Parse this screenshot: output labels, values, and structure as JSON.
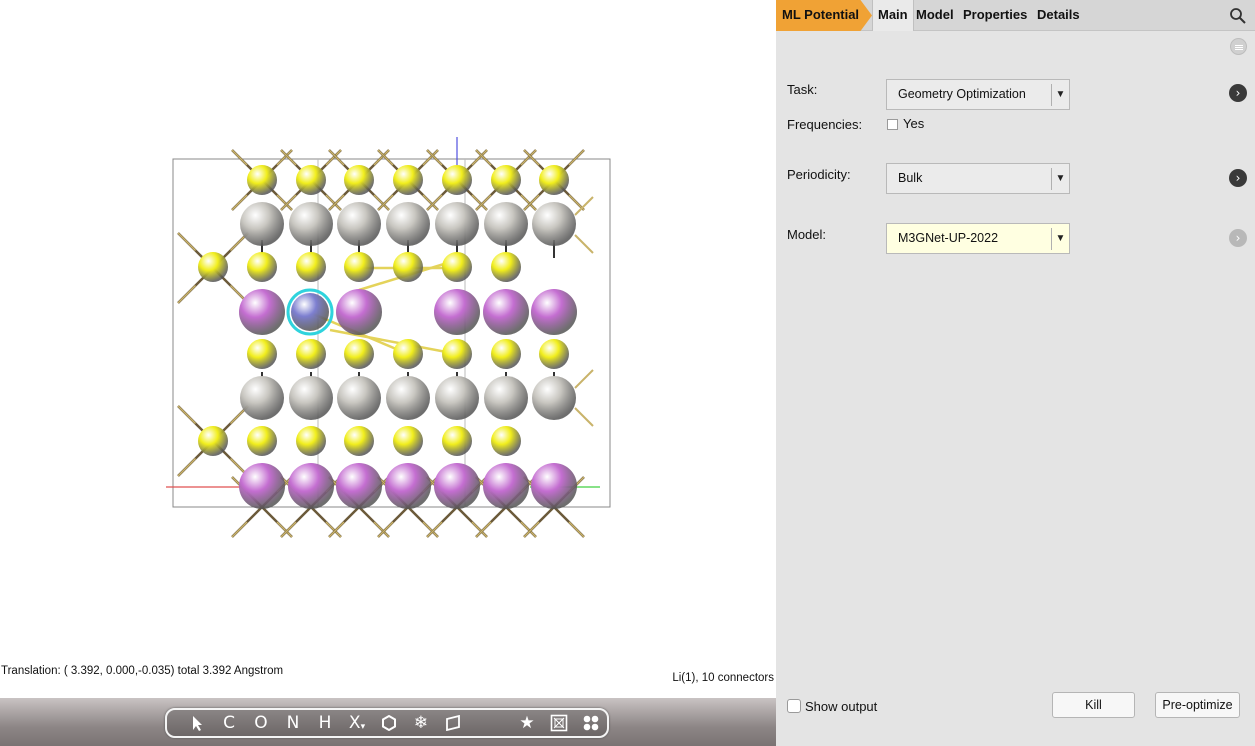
{
  "viewer": {
    "status_left": "Translation: ( 3.392, 0.000,-0.035) total  3.392 Angstrom",
    "status_right": "Li(1), 10 connectors",
    "colors": {
      "S": "#f1ee1c",
      "Ti": "#c8c6c0",
      "Li": "#c46ed1",
      "selected": "#7d7fd0",
      "highlight": "#2fd3dd"
    }
  },
  "toolbar": {
    "tools": [
      "pointer-icon",
      "C",
      "O",
      "N",
      "H",
      "X",
      "ring-icon",
      "freeze-icon",
      "plane-icon",
      "star-icon",
      "frame-icon",
      "cluster-icon"
    ],
    "labels": {
      "carbon": "C",
      "oxygen": "O",
      "nitrogen": "N",
      "hydrogen": "H",
      "other": "X"
    }
  },
  "panel": {
    "tabs": {
      "ml": "ML Potential",
      "main": "Main",
      "model": "Model",
      "properties": "Properties",
      "details": "Details"
    },
    "task_label": "Task:",
    "task_value": "Geometry Optimization",
    "frequencies_label": "Frequencies:",
    "frequencies_option": "Yes",
    "periodicity_label": "Periodicity:",
    "periodicity_value": "Bulk",
    "model_label": "Model:",
    "model_value": "M3GNet-UP-2022",
    "show_output": "Show output",
    "kill": "Kill",
    "preoptimize": "Pre-optimize",
    "accent": "#f0a235"
  }
}
